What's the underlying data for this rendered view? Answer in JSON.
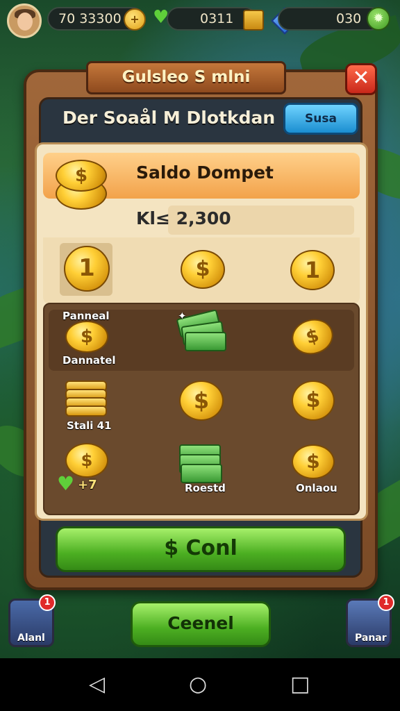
{
  "topbar": {
    "coins_value": "70 33300",
    "gems_value": "0311",
    "energy_value": "030",
    "coin_plus": "+"
  },
  "dialog": {
    "title": "Gulsleo S mlni",
    "close_label": "✕",
    "subtitle": "Der Soaål M Dlotkdan",
    "blue_button": "Susa"
  },
  "wallet": {
    "header": "Saldo Dompet",
    "amount": "Kl≤ 2,300"
  },
  "items": {
    "top_left_value": "1",
    "top_right_value": "1",
    "row1_label_top": "Panneal",
    "row1_label_bottom": "Dannatel",
    "row2_label": "Stali 41",
    "row3_left_label": "+7",
    "row3_mid_label": "Roestd",
    "row3_right_label": "Onlaou"
  },
  "buttons": {
    "primary": "$ Conl",
    "secondary": "Ceenel"
  },
  "side_cards": {
    "left_label": "Alanl",
    "left_badge": "1",
    "right_label": "Panar",
    "right_badge": "1"
  },
  "navbar": {
    "back_icon": "◁",
    "home_icon": "○",
    "recent_icon": "□"
  },
  "colors": {
    "panel": "#8a5430",
    "accent_green": "#4caf22",
    "close_red": "#d9342a",
    "blue": "#1b8ed0"
  }
}
